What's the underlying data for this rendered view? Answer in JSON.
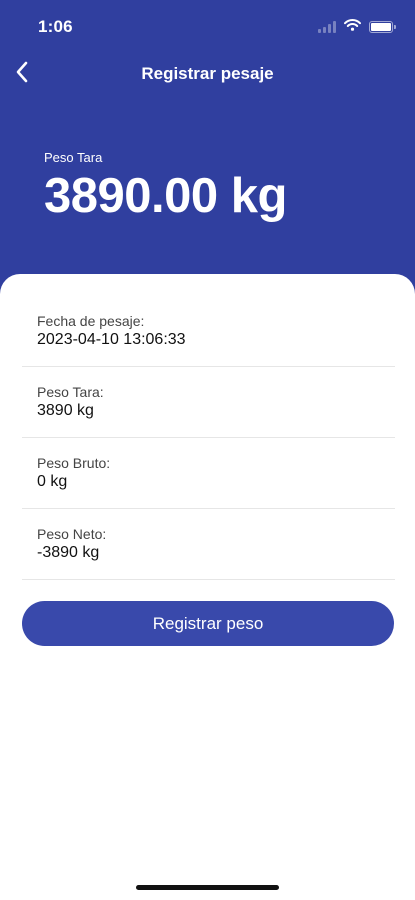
{
  "status_bar": {
    "time": "1:06",
    "icons": [
      "signal-icon",
      "wifi-icon",
      "battery-icon"
    ]
  },
  "nav": {
    "title": "Registrar pesaje",
    "back_icon": "chevron-left-icon"
  },
  "hero": {
    "label": "Peso Tara",
    "value": "3890.00 kg"
  },
  "details": [
    {
      "label": "Fecha de pesaje:",
      "value": "2023-04-10 13:06:33"
    },
    {
      "label": "Peso Tara:",
      "value": "3890 kg"
    },
    {
      "label": "Peso Bruto:",
      "value": "0 kg"
    },
    {
      "label": "Peso Neto:",
      "value": "-3890 kg"
    }
  ],
  "actions": {
    "register_label": "Registrar peso"
  },
  "colors": {
    "header_bg": "#303f9f",
    "button_bg": "#3949ab",
    "card_bg": "#ffffff",
    "divider": "#e6e6e6"
  }
}
